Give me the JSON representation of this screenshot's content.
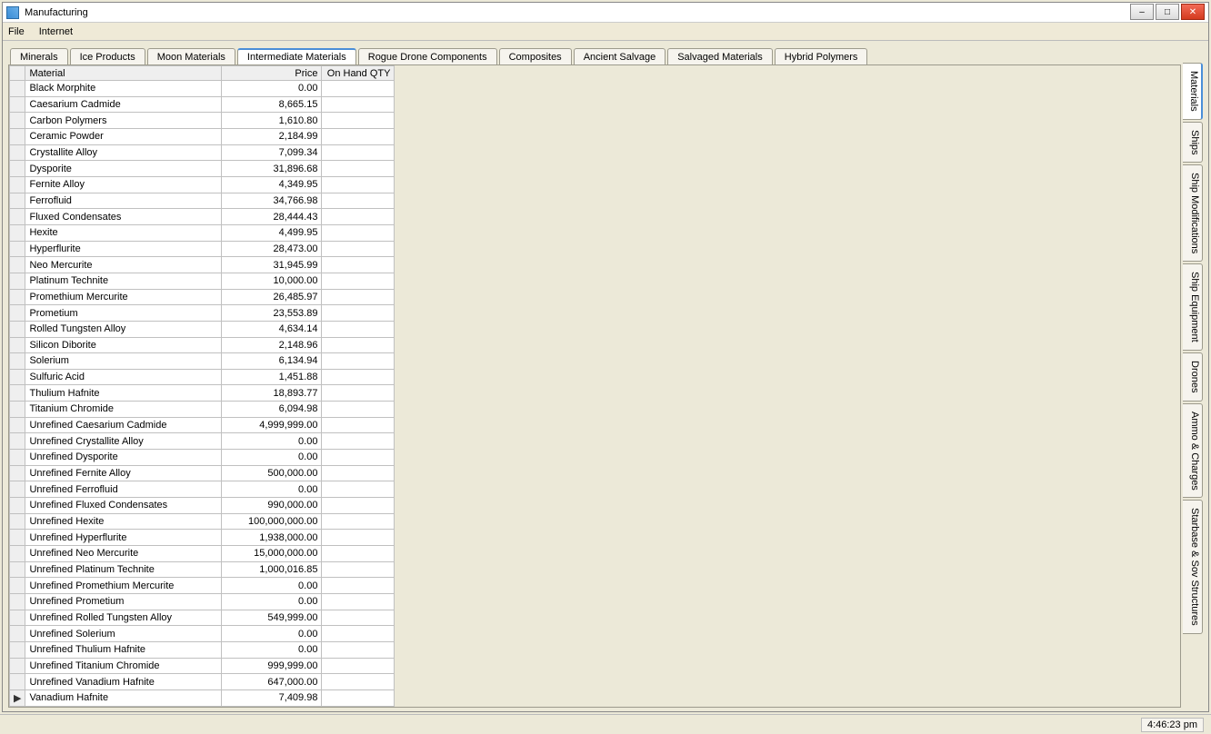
{
  "window": {
    "title": "Manufacturing"
  },
  "menu": {
    "file": "File",
    "internet": "Internet"
  },
  "topTabs": [
    "Minerals",
    "Ice Products",
    "Moon Materials",
    "Intermediate Materials",
    "Rogue Drone Components",
    "Composites",
    "Ancient Salvage",
    "Salvaged Materials",
    "Hybrid Polymers"
  ],
  "topTabsActiveIndex": 3,
  "sideTabs": [
    "Materials",
    "Ships",
    "Ship Modifications",
    "Ship Equipment",
    "Drones",
    "Ammo & Charges",
    "Starbase & Sov Structures"
  ],
  "sideTabsActiveIndex": 0,
  "columns": {
    "material": "Material",
    "price": "Price",
    "qty": "On Hand QTY"
  },
  "rows": [
    {
      "material": "Black Morphite",
      "price": "0.00",
      "qty": ""
    },
    {
      "material": "Caesarium Cadmide",
      "price": "8,665.15",
      "qty": ""
    },
    {
      "material": "Carbon Polymers",
      "price": "1,610.80",
      "qty": ""
    },
    {
      "material": "Ceramic Powder",
      "price": "2,184.99",
      "qty": ""
    },
    {
      "material": "Crystallite Alloy",
      "price": "7,099.34",
      "qty": ""
    },
    {
      "material": "Dysporite",
      "price": "31,896.68",
      "qty": ""
    },
    {
      "material": "Fernite Alloy",
      "price": "4,349.95",
      "qty": ""
    },
    {
      "material": "Ferrofluid",
      "price": "34,766.98",
      "qty": ""
    },
    {
      "material": "Fluxed Condensates",
      "price": "28,444.43",
      "qty": ""
    },
    {
      "material": "Hexite",
      "price": "4,499.95",
      "qty": ""
    },
    {
      "material": "Hyperflurite",
      "price": "28,473.00",
      "qty": ""
    },
    {
      "material": "Neo Mercurite",
      "price": "31,945.99",
      "qty": ""
    },
    {
      "material": "Platinum Technite",
      "price": "10,000.00",
      "qty": ""
    },
    {
      "material": "Promethium Mercurite",
      "price": "26,485.97",
      "qty": ""
    },
    {
      "material": "Prometium",
      "price": "23,553.89",
      "qty": ""
    },
    {
      "material": "Rolled Tungsten Alloy",
      "price": "4,634.14",
      "qty": ""
    },
    {
      "material": "Silicon Diborite",
      "price": "2,148.96",
      "qty": ""
    },
    {
      "material": "Solerium",
      "price": "6,134.94",
      "qty": ""
    },
    {
      "material": "Sulfuric Acid",
      "price": "1,451.88",
      "qty": ""
    },
    {
      "material": "Thulium Hafnite",
      "price": "18,893.77",
      "qty": ""
    },
    {
      "material": "Titanium Chromide",
      "price": "6,094.98",
      "qty": ""
    },
    {
      "material": "Unrefined Caesarium Cadmide",
      "price": "4,999,999.00",
      "qty": ""
    },
    {
      "material": "Unrefined Crystallite Alloy",
      "price": "0.00",
      "qty": ""
    },
    {
      "material": "Unrefined Dysporite",
      "price": "0.00",
      "qty": ""
    },
    {
      "material": "Unrefined Fernite Alloy",
      "price": "500,000.00",
      "qty": ""
    },
    {
      "material": "Unrefined Ferrofluid",
      "price": "0.00",
      "qty": ""
    },
    {
      "material": "Unrefined Fluxed Condensates",
      "price": "990,000.00",
      "qty": ""
    },
    {
      "material": "Unrefined Hexite",
      "price": "100,000,000.00",
      "qty": ""
    },
    {
      "material": "Unrefined Hyperflurite",
      "price": "1,938,000.00",
      "qty": ""
    },
    {
      "material": "Unrefined Neo Mercurite",
      "price": "15,000,000.00",
      "qty": ""
    },
    {
      "material": "Unrefined Platinum Technite",
      "price": "1,000,016.85",
      "qty": ""
    },
    {
      "material": "Unrefined Promethium Mercurite",
      "price": "0.00",
      "qty": ""
    },
    {
      "material": "Unrefined Prometium",
      "price": "0.00",
      "qty": ""
    },
    {
      "material": "Unrefined Rolled Tungsten Alloy",
      "price": "549,999.00",
      "qty": ""
    },
    {
      "material": "Unrefined Solerium",
      "price": "0.00",
      "qty": ""
    },
    {
      "material": "Unrefined Thulium Hafnite",
      "price": "0.00",
      "qty": ""
    },
    {
      "material": "Unrefined Titanium Chromide",
      "price": "999,999.00",
      "qty": ""
    },
    {
      "material": "Unrefined Vanadium Hafnite",
      "price": "647,000.00",
      "qty": ""
    },
    {
      "material": "Vanadium Hafnite",
      "price": "7,409.98",
      "qty": ""
    }
  ],
  "selectedRowIndex": 38,
  "clock": "4:46:23 pm"
}
